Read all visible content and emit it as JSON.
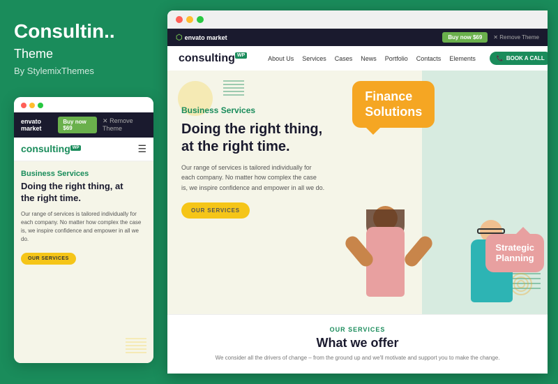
{
  "left": {
    "title": "Consultin..",
    "subtitle": "Theme",
    "by": "By StylemixThemes",
    "mobile": {
      "traffic_dots": [
        "red",
        "yellow",
        "green"
      ],
      "topbar": {
        "logo": "envato market",
        "buy_label": "Buy now $69",
        "close": "✕ Remove Theme"
      },
      "nav": {
        "logo": "consulting",
        "wp": "WP",
        "hamburger": "☰"
      },
      "hero": {
        "business_services": "Business Services",
        "heading_line1": "Doing the right thing, at",
        "heading_line2": "the right time.",
        "body": "Our range of services is tailored individually for each company. No matter how complex the case is, we inspire confidence and empower in all we do.",
        "cta": "OUR SERVICES"
      }
    }
  },
  "right": {
    "traffic_dots": [
      "red",
      "yellow",
      "green"
    ],
    "topbar": {
      "logo": "envato market",
      "buy_label": "Buy now $69",
      "remove": "✕ Remove Theme"
    },
    "nav": {
      "logo": "consulting",
      "wp": "WP",
      "links": [
        "About Us",
        "Services",
        "Cases",
        "News",
        "Portfolio",
        "Contacts",
        "Elements"
      ],
      "cta": "BOOK A CALL"
    },
    "hero": {
      "business_services": "Business Services",
      "heading": "Doing the right thing,\nat the right time.",
      "body": "Our range of services is tailored individually for each company. No matter how complex the case is, we inspire confidence and empower in all we do.",
      "cta": "OUR SERVICES",
      "bubble_orange_line1": "Finance",
      "bubble_orange_line2": "Solutions",
      "bubble_pink_line1": "Strategic",
      "bubble_pink_line2": "Planning"
    },
    "bottom": {
      "label": "OUR SERVICES",
      "heading": "What we offer",
      "body": "We consider all the drivers of change – from the ground up and we'll motivate and support you to make the change."
    }
  }
}
